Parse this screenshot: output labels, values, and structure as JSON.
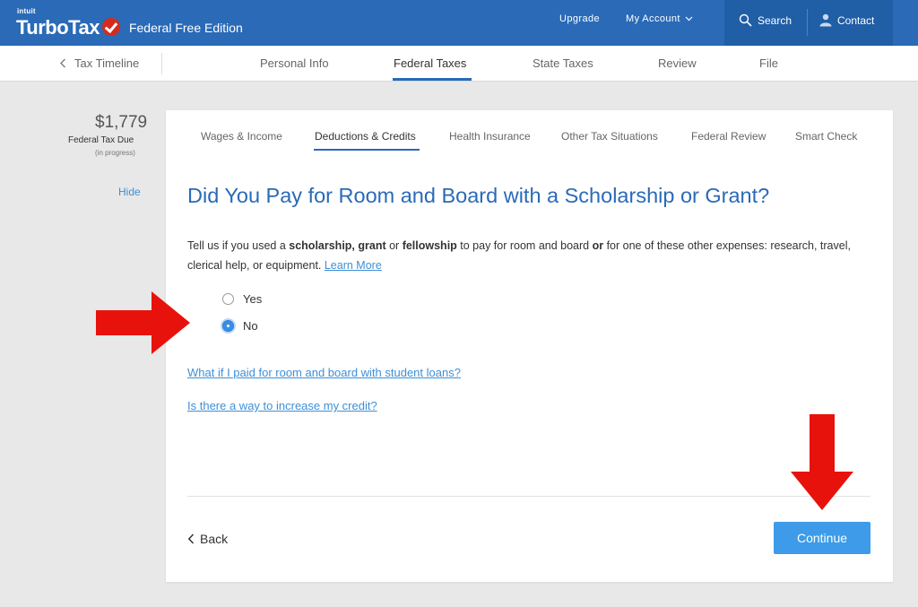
{
  "header": {
    "brand_small": "intuit",
    "brand_name": "TurboTax",
    "edition": "Federal Free Edition",
    "upgrade": "Upgrade",
    "my_account": "My Account",
    "search": "Search",
    "contact": "Contact"
  },
  "nav": {
    "back": "Tax Timeline",
    "items": [
      "Personal Info",
      "Federal Taxes",
      "State Taxes",
      "Review",
      "File"
    ],
    "active": "Federal Taxes"
  },
  "summary": {
    "amount": "$1,779",
    "label": "Federal Tax Due",
    "sub": "(in progress)",
    "hide": "Hide"
  },
  "subtabs": [
    "Wages & Income",
    "Deductions & Credits",
    "Health Insurance",
    "Other Tax Situations",
    "Federal Review",
    "Smart Check"
  ],
  "question": {
    "title": "Did You Pay for Room and Board with a Scholarship or Grant?",
    "desc_1": "Tell us if you used a ",
    "desc_b1": "scholarship, grant",
    "desc_2": " or ",
    "desc_b2": "fellowship",
    "desc_3": " to pay for room and board ",
    "desc_b3": "or",
    "desc_4": " for one of these other expenses: research, travel, clerical help, or equipment. ",
    "learn_more": "Learn More",
    "options": [
      "Yes",
      "No"
    ],
    "selected": "No"
  },
  "help_links": [
    "What if I paid for room and board with student loans?",
    "Is there a way to increase my credit?"
  ],
  "footer": {
    "back": "Back",
    "continue": "Continue"
  },
  "colors": {
    "brand_blue": "#2a6ab7",
    "link_blue": "#3e8fd6",
    "button_blue": "#3d9be9",
    "annotation_red": "#e8120c"
  }
}
